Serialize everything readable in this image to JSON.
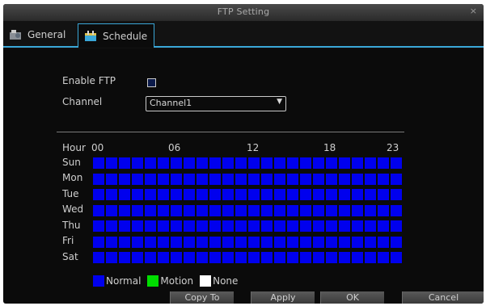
{
  "window": {
    "title": "FTP Setting",
    "close_glyph": "×"
  },
  "tabs": [
    {
      "label": "General",
      "icon": "settings-icon",
      "active": false
    },
    {
      "label": "Schedule",
      "icon": "schedule-icon",
      "active": true
    }
  ],
  "form": {
    "enable_label": "Enable FTP",
    "enable_checked": false,
    "channel_label": "Channel",
    "channel_value": "Channel1"
  },
  "schedule": {
    "hour_label": "Hour",
    "hour_ticks": [
      "00",
      "06",
      "12",
      "18",
      "23"
    ],
    "days": [
      "Sun",
      "Mon",
      "Tue",
      "Wed",
      "Thu",
      "Fri",
      "Sat"
    ],
    "hours_count": 24,
    "default_mode": "Normal"
  },
  "legend": [
    {
      "label": "Normal",
      "color": "#0000ee"
    },
    {
      "label": "Motion",
      "color": "#00dd00"
    },
    {
      "label": "None",
      "color": "#ffffff"
    }
  ],
  "buttons": {
    "copy_to": "Copy To",
    "apply": "Apply",
    "ok": "OK",
    "cancel": "Cancel"
  },
  "colors": {
    "accent": "#3aa7d8",
    "normal": "#0000ee",
    "motion": "#00dd00",
    "none": "#ffffff"
  }
}
